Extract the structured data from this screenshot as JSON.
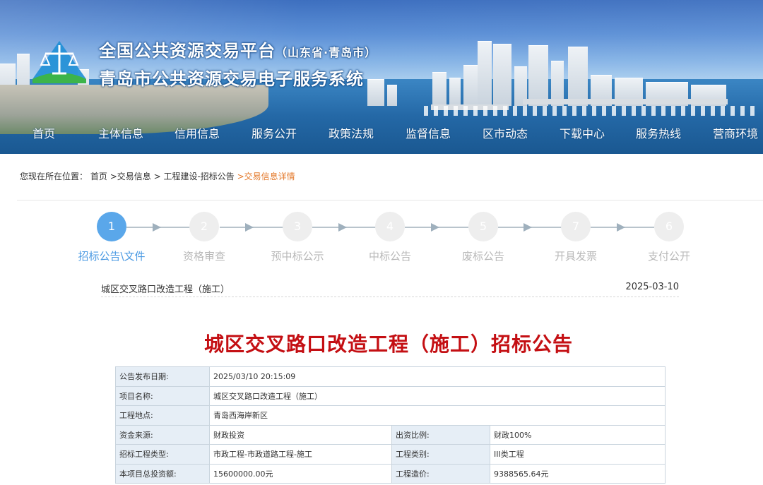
{
  "header": {
    "title_line1": "全国公共资源交易平台",
    "title_line1_sub": "（山东省·青岛市）",
    "title_line2": "青岛市公共资源交易电子服务系统",
    "logo_icon": "scales-of-justice-logo"
  },
  "nav": {
    "items": [
      "首页",
      "主体信息",
      "信用信息",
      "服务公开",
      "政策法规",
      "监督信息",
      "区市动态",
      "下载中心",
      "服务热线",
      "营商环境"
    ]
  },
  "breadcrumb": {
    "prefix": "您现在所在位置：",
    "home": "首页",
    "level1": ">交易信息",
    "level2": "> 工程建设-招标公告",
    "current": ">交易信息详情"
  },
  "steps": [
    {
      "num": "1",
      "label": "招标公告\\文件",
      "active": true
    },
    {
      "num": "2",
      "label": "资格审查",
      "active": false
    },
    {
      "num": "3",
      "label": "预中标公示",
      "active": false
    },
    {
      "num": "4",
      "label": "中标公告",
      "active": false
    },
    {
      "num": "5",
      "label": "废标公告",
      "active": false
    },
    {
      "num": "7",
      "label": "开具发票",
      "active": false
    },
    {
      "num": "6",
      "label": "支付公开",
      "active": false
    }
  ],
  "project": {
    "name": "城区交叉路口改造工程（施工）",
    "date": "2025-03-10"
  },
  "notice": {
    "title": "城区交叉路口改造工程（施工）招标公告"
  },
  "table": {
    "publish_date_label": "公告发布日期:",
    "publish_date_value": "2025/03/10 20:15:09",
    "project_name_label": "项目名称:",
    "project_name_value": "城区交叉路口改造工程（施工）",
    "location_label": "工程地点:",
    "location_value": "青岛西海岸新区",
    "fund_source_label": "资金来源:",
    "fund_source_value": "财政投资",
    "fund_ratio_label": "出资比例:",
    "fund_ratio_value": "财政100%",
    "bid_type_label": "招标工程类型:",
    "bid_type_value": "市政工程-市政道路工程-施工",
    "category_label": "工程类别:",
    "category_value": "III类工程",
    "total_invest_label": "本项目总投资额:",
    "total_invest_value": "15600000.00元",
    "cost_label": "工程造价:",
    "cost_value": "9388565.64元"
  },
  "colors": {
    "active_step": "#5aa7ea",
    "title_red": "#c40f13",
    "breadcrumb_current": "#e47a2c"
  }
}
